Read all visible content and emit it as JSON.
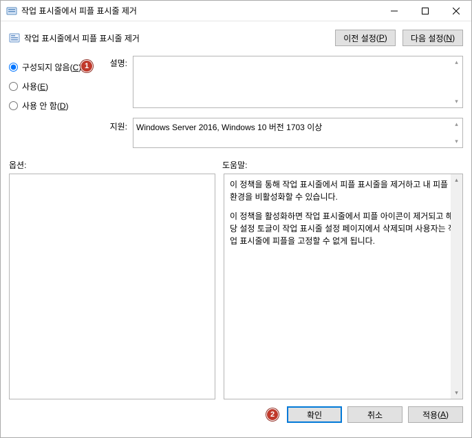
{
  "window": {
    "title": "작업 표시줄에서 피플 표시줄 제거"
  },
  "header": {
    "title": "작업 표시줄에서 피플 표시줄 제거",
    "prev_button": {
      "text": "이전 설정",
      "accel": "P"
    },
    "next_button": {
      "text": "다음 설정",
      "accel": "N"
    }
  },
  "radios": {
    "not_configured": {
      "label": "구성되지 않음",
      "accel": "C",
      "checked": true
    },
    "enabled": {
      "label": "사용",
      "accel": "E",
      "checked": false
    },
    "disabled": {
      "label": "사용 안 함",
      "accel": "D",
      "checked": false
    }
  },
  "badges": {
    "one": "1",
    "two": "2"
  },
  "labels": {
    "description": "설명:",
    "supported": "지원:",
    "options": "옵션:",
    "help": "도움말:"
  },
  "fields": {
    "description": "",
    "supported": "Windows Server 2016, Windows 10 버전 1703 이상"
  },
  "help": {
    "p1": "이 정책을 통해 작업 표시줄에서 피플 표시줄을 제거하고 내 피플 환경을 비활성화할 수 있습니다.",
    "p2": "이 정책을 활성화하면 작업 표시줄에서 피플 아이콘이 제거되고 해당 설정 토글이 작업 표시줄 설정 페이지에서 삭제되며 사용자는 작업 표시줄에 피플을 고정할 수 없게 됩니다."
  },
  "buttons": {
    "ok": "확인",
    "cancel": "취소",
    "apply": {
      "text": "적용",
      "accel": "A"
    }
  }
}
